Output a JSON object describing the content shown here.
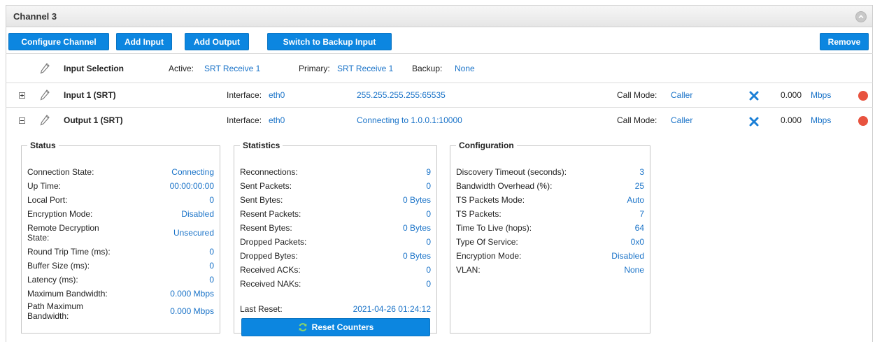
{
  "channel": {
    "title": "Channel 3"
  },
  "toolbar": {
    "configure_label": "Configure Channel",
    "add_input_label": "Add Input",
    "add_output_label": "Add Output",
    "switch_backup_label": "Switch to Backup Input",
    "remove_label": "Remove"
  },
  "input_selection": {
    "label": "Input Selection",
    "active_label": "Active:",
    "active_value": "SRT Receive 1",
    "primary_label": "Primary:",
    "primary_value": "SRT Receive 1",
    "backup_label": "Backup:",
    "backup_value": "None"
  },
  "input1": {
    "name": "Input 1 (SRT)",
    "interface_label": "Interface:",
    "interface_value": "eth0",
    "address": "255.255.255.255:65535",
    "call_mode_label": "Call Mode:",
    "call_mode_value": "Caller",
    "rate": "0.000",
    "rate_unit": "Mbps",
    "status_color": "#e8533f"
  },
  "output1": {
    "name": "Output 1 (SRT)",
    "interface_label": "Interface:",
    "interface_value": "eth0",
    "address": "Connecting to 1.0.0.1:10000",
    "call_mode_label": "Call Mode:",
    "call_mode_value": "Caller",
    "rate": "0.000",
    "rate_unit": "Mbps",
    "status_color": "#e8533f"
  },
  "status": {
    "legend": "Status",
    "rows": [
      {
        "k": "Connection State:",
        "v": "Connecting"
      },
      {
        "k": "Up Time:",
        "v": "00:00:00:00"
      },
      {
        "k": "Local Port:",
        "v": "0"
      },
      {
        "k": "Encryption Mode:",
        "v": "Disabled"
      },
      {
        "k": "Remote Decryption State:",
        "v": "Unsecured"
      },
      {
        "k": "Round Trip Time (ms):",
        "v": "0"
      },
      {
        "k": "Buffer Size (ms):",
        "v": "0"
      },
      {
        "k": "Latency (ms):",
        "v": "0"
      },
      {
        "k": "Maximum Bandwidth:",
        "v": "0.000 Mbps"
      },
      {
        "k": "Path Maximum Bandwidth:",
        "v": "0.000 Mbps"
      }
    ]
  },
  "statistics": {
    "legend": "Statistics",
    "rows": [
      {
        "k": "Reconnections:",
        "v": "9"
      },
      {
        "k": "Sent Packets:",
        "v": "0"
      },
      {
        "k": "Sent Bytes:",
        "v": "0 Bytes"
      },
      {
        "k": "Resent Packets:",
        "v": "0"
      },
      {
        "k": "Resent Bytes:",
        "v": "0 Bytes"
      },
      {
        "k": "Dropped Packets:",
        "v": "0"
      },
      {
        "k": "Dropped Bytes:",
        "v": "0 Bytes"
      },
      {
        "k": "Received ACKs:",
        "v": "0"
      },
      {
        "k": "Received NAKs:",
        "v": "0"
      }
    ],
    "last_reset_label": "Last Reset:",
    "last_reset_value": "2021-04-26 01:24:12",
    "reset_button_label": "Reset Counters"
  },
  "configuration": {
    "legend": "Configuration",
    "rows": [
      {
        "k": "Discovery Timeout (seconds):",
        "v": "3"
      },
      {
        "k": "Bandwidth Overhead (%):",
        "v": "25"
      },
      {
        "k": "TS Packets Mode:",
        "v": "Auto"
      },
      {
        "k": "TS Packets:",
        "v": "7"
      },
      {
        "k": "Time To Live (hops):",
        "v": "64"
      },
      {
        "k": "Type Of Service:",
        "v": "0x0"
      },
      {
        "k": "Encryption Mode:",
        "v": "Disabled"
      },
      {
        "k": "VLAN:",
        "v": "None"
      }
    ]
  },
  "icons": {
    "edit": "pencil-icon",
    "expand": "plus-box-icon",
    "collapse": "minus-box-icon",
    "delete": "x-icon",
    "status": "status-dot-icon",
    "refresh": "refresh-icon",
    "panel_toggle": "chevron-up-icon"
  },
  "colors": {
    "accent": "#0c86e0",
    "link": "#1a73c8",
    "danger": "#e8533f"
  }
}
